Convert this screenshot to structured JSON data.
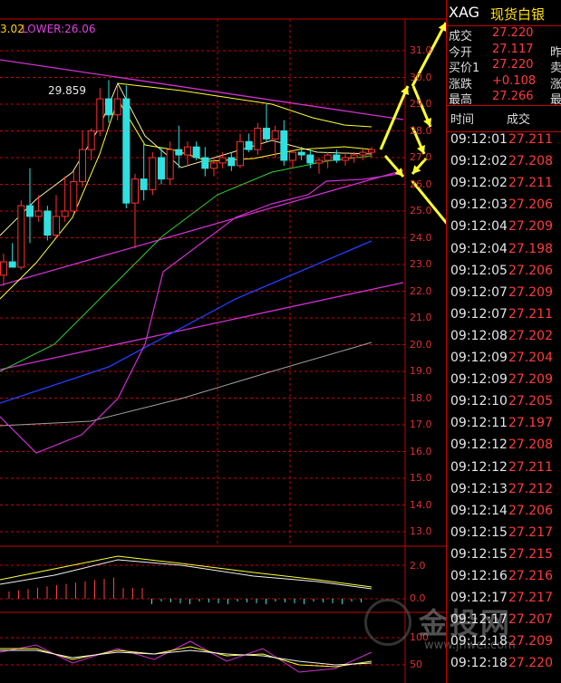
{
  "indicator_legend": {
    "value_a": "3.02",
    "lower": "LOWER:26.06"
  },
  "high_annotation": "29.859",
  "price_axis": [
    "31.0",
    "30.0",
    "29.0",
    "28.0",
    "27.0",
    "26.0",
    "25.0",
    "24.0",
    "23.0",
    "22.0",
    "21.0",
    "20.0",
    "19.0",
    "18.0",
    "17.0",
    "16.0",
    "15.0",
    "14.0",
    "13.0"
  ],
  "macd_axis": [
    "2.0",
    "0.0"
  ],
  "kdj_axis": [
    "100",
    "50"
  ],
  "quote": {
    "symbol": "XAG",
    "name": "现货白银",
    "rows": [
      {
        "label": "成交",
        "value": "27.220",
        "right": ""
      },
      {
        "label": "今开",
        "value": "27.117",
        "right": "昨"
      },
      {
        "label": "买价1",
        "value": "27.220",
        "right": "卖"
      },
      {
        "label": "涨跌",
        "value": "+0.108",
        "right": "涨"
      },
      {
        "label": "最高",
        "value": "27.266",
        "right": "最"
      }
    ]
  },
  "trades_header": {
    "time": "时间",
    "price": "成交"
  },
  "trades": [
    {
      "time": "09:12:01",
      "price": "27.211"
    },
    {
      "time": "09:12:02",
      "price": "27.208"
    },
    {
      "time": "09:12:02",
      "price": "27.211"
    },
    {
      "time": "09:12:03",
      "price": "27.206"
    },
    {
      "time": "09:12:04",
      "price": "27.209"
    },
    {
      "time": "09:12:04",
      "price": "27.198"
    },
    {
      "time": "09:12:05",
      "price": "27.206"
    },
    {
      "time": "09:12:07",
      "price": "27.209"
    },
    {
      "time": "09:12:07",
      "price": "27.211"
    },
    {
      "time": "09:12:08",
      "price": "27.202"
    },
    {
      "time": "09:12:09",
      "price": "27.204"
    },
    {
      "time": "09:12:09",
      "price": "27.209"
    },
    {
      "time": "09:12:10",
      "price": "27.205"
    },
    {
      "time": "09:12:11",
      "price": "27.197"
    },
    {
      "time": "09:12:12",
      "price": "27.208"
    },
    {
      "time": "09:12:12",
      "price": "27.211"
    },
    {
      "time": "09:12:13",
      "price": "27.212"
    },
    {
      "time": "09:12:14",
      "price": "27.206"
    },
    {
      "time": "09:12:15",
      "price": "27.217"
    },
    {
      "time": "09:12:15",
      "price": "27.215"
    },
    {
      "time": "09:12:16",
      "price": "27.216"
    },
    {
      "time": "09:12:17",
      "price": "27.217"
    },
    {
      "time": "09:12:17",
      "price": "27.207"
    },
    {
      "time": "09:12:18",
      "price": "27.209"
    },
    {
      "time": "09:12:18",
      "price": "27.220"
    }
  ],
  "watermark": {
    "brand": "金投网",
    "url": "www.jnwei.com"
  },
  "colors": {
    "grid": "#c80000",
    "axis_text": "#e03030",
    "price": "#ff3b3b",
    "up": "#ff3030",
    "down": "#30e0e0",
    "annotation": "#ffff30"
  },
  "candles": [
    {
      "o": 22.6,
      "h": 23.4,
      "l": 22.2,
      "c": 23.1
    },
    {
      "o": 23.1,
      "h": 23.8,
      "l": 22.9,
      "c": 22.9
    },
    {
      "o": 22.9,
      "h": 25.4,
      "l": 22.8,
      "c": 25.2
    },
    {
      "o": 25.2,
      "h": 26.6,
      "l": 23.8,
      "c": 24.8
    },
    {
      "o": 24.8,
      "h": 25.6,
      "l": 24.6,
      "c": 25.0
    },
    {
      "o": 25.0,
      "h": 25.2,
      "l": 23.9,
      "c": 24.1
    },
    {
      "o": 24.1,
      "h": 25.6,
      "l": 24.0,
      "c": 24.8
    },
    {
      "o": 24.8,
      "h": 26.3,
      "l": 24.6,
      "c": 25.0
    },
    {
      "o": 25.0,
      "h": 26.5,
      "l": 24.9,
      "c": 26.1
    },
    {
      "o": 26.1,
      "h": 28.0,
      "l": 25.9,
      "c": 27.3
    },
    {
      "o": 27.3,
      "h": 28.1,
      "l": 26.9,
      "c": 28.0
    },
    {
      "o": 28.0,
      "h": 29.6,
      "l": 27.8,
      "c": 29.2
    },
    {
      "o": 29.2,
      "h": 29.9,
      "l": 28.3,
      "c": 28.6
    },
    {
      "o": 28.6,
      "h": 29.7,
      "l": 28.4,
      "c": 29.2
    },
    {
      "o": 29.2,
      "h": 29.7,
      "l": 25.1,
      "c": 25.3
    },
    {
      "o": 25.3,
      "h": 26.4,
      "l": 23.6,
      "c": 26.2
    },
    {
      "o": 26.2,
      "h": 27.6,
      "l": 25.4,
      "c": 25.8
    },
    {
      "o": 25.8,
      "h": 27.2,
      "l": 25.6,
      "c": 27.0
    },
    {
      "o": 27.0,
      "h": 27.4,
      "l": 26.0,
      "c": 26.2
    },
    {
      "o": 26.2,
      "h": 27.6,
      "l": 26.0,
      "c": 27.3
    },
    {
      "o": 27.3,
      "h": 28.2,
      "l": 26.6,
      "c": 27.1
    },
    {
      "o": 27.1,
      "h": 27.6,
      "l": 26.7,
      "c": 27.4
    },
    {
      "o": 27.4,
      "h": 27.6,
      "l": 26.9,
      "c": 27.0
    },
    {
      "o": 27.0,
      "h": 27.4,
      "l": 26.3,
      "c": 26.6
    },
    {
      "o": 26.6,
      "h": 27.0,
      "l": 26.3,
      "c": 26.8
    },
    {
      "o": 26.8,
      "h": 27.2,
      "l": 26.6,
      "c": 27.0
    },
    {
      "o": 27.0,
      "h": 27.2,
      "l": 26.5,
      "c": 26.7
    },
    {
      "o": 26.7,
      "h": 27.9,
      "l": 26.6,
      "c": 27.6
    },
    {
      "o": 27.6,
      "h": 27.9,
      "l": 27.2,
      "c": 27.3
    },
    {
      "o": 27.3,
      "h": 28.3,
      "l": 27.1,
      "c": 28.1
    },
    {
      "o": 28.1,
      "h": 29.0,
      "l": 27.6,
      "c": 27.7
    },
    {
      "o": 27.7,
      "h": 28.2,
      "l": 27.0,
      "c": 28.0
    },
    {
      "o": 28.0,
      "h": 28.4,
      "l": 26.7,
      "c": 26.9
    },
    {
      "o": 26.9,
      "h": 27.3,
      "l": 26.6,
      "c": 27.2
    },
    {
      "o": 27.2,
      "h": 27.4,
      "l": 26.9,
      "c": 27.1
    },
    {
      "o": 27.1,
      "h": 27.3,
      "l": 26.6,
      "c": 26.8
    },
    {
      "o": 26.8,
      "h": 27.0,
      "l": 26.4,
      "c": 26.9
    },
    {
      "o": 26.9,
      "h": 27.2,
      "l": 26.6,
      "c": 27.1
    },
    {
      "o": 27.1,
      "h": 27.3,
      "l": 26.8,
      "c": 26.9
    },
    {
      "o": 26.9,
      "h": 27.2,
      "l": 26.7,
      "c": 27.0
    },
    {
      "o": 27.0,
      "h": 27.2,
      "l": 26.8,
      "c": 27.1
    },
    {
      "o": 27.1,
      "h": 27.3,
      "l": 26.9,
      "c": 27.2
    },
    {
      "o": 27.2,
      "h": 27.4,
      "l": 27.0,
      "c": 27.3
    }
  ]
}
